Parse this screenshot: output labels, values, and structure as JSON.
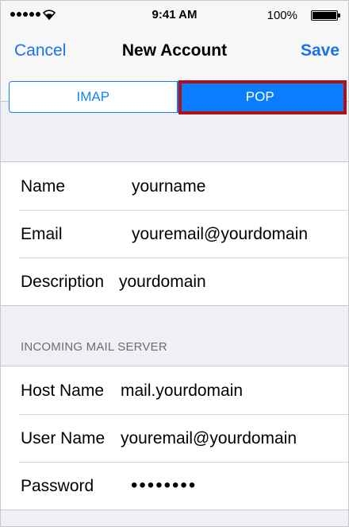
{
  "status_bar": {
    "time": "9:41 AM",
    "battery_percent": "100%",
    "signal_icon": "signal-dots-icon",
    "wifi_icon": "wifi-icon",
    "battery_icon": "battery-icon",
    "battery_level": 1.0
  },
  "nav": {
    "cancel_label": "Cancel",
    "title": "New Account",
    "save_label": "Save",
    "accent_color": "#1a73e8"
  },
  "segment": {
    "options": [
      "IMAP",
      "POP"
    ],
    "selected": "POP",
    "highlight_color": "#b0101a"
  },
  "account_fields": [
    {
      "label": "Name",
      "value": "yourname"
    },
    {
      "label": "Email",
      "value": "youremail@yourdomain"
    },
    {
      "label": "Description",
      "value": "yourdomain"
    }
  ],
  "incoming_section": {
    "header": "INCOMING MAIL SERVER",
    "fields": [
      {
        "label": "Host Name",
        "value": "mail.yourdomain"
      },
      {
        "label": "User Name",
        "value": "youremail@yourdomain"
      },
      {
        "label": "Password",
        "value": "••••••••"
      }
    ]
  }
}
